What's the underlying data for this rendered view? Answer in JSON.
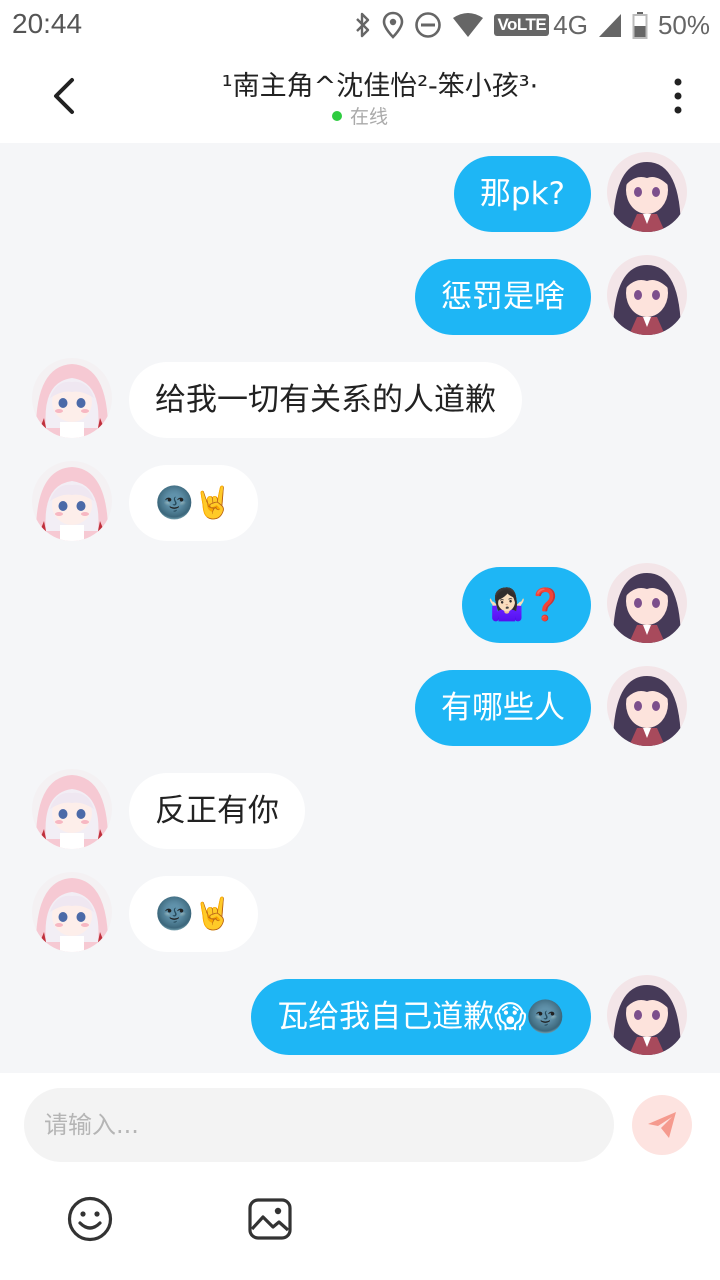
{
  "status_bar": {
    "time": "20:44",
    "volte": "VoLTE",
    "network": "4G",
    "battery": "50%",
    "icons": [
      "bluetooth-icon",
      "location-icon",
      "do-not-disturb-icon",
      "wifi-icon",
      "signal-icon",
      "battery-icon"
    ]
  },
  "header": {
    "title": "¹南主角^沈佳怡²-笨小孩³·",
    "status": "在线",
    "status_color": "#2ecc40"
  },
  "messages": [
    {
      "side": "out",
      "text": "那pk?"
    },
    {
      "side": "out",
      "text": "惩罚是啥"
    },
    {
      "side": "in",
      "text": "给我一切有关系的人道歉"
    },
    {
      "side": "in",
      "text": "🌚🤘"
    },
    {
      "side": "out",
      "text": "🤷🏻‍♀️❓"
    },
    {
      "side": "out",
      "text": "有哪些人"
    },
    {
      "side": "in",
      "text": "反正有你"
    },
    {
      "side": "in",
      "text": "🌚🤘"
    },
    {
      "side": "out",
      "text": "瓦给我自己道歉😱🌚"
    }
  ],
  "composer": {
    "placeholder": "请输入...",
    "send_icon": "paper-plane-icon",
    "emoji_icon": "smiley-icon",
    "image_icon": "image-icon"
  },
  "colors": {
    "outgoing_bubble": "#1eb6f5",
    "incoming_bubble": "#ffffff",
    "chat_background": "#f5f6f8"
  }
}
